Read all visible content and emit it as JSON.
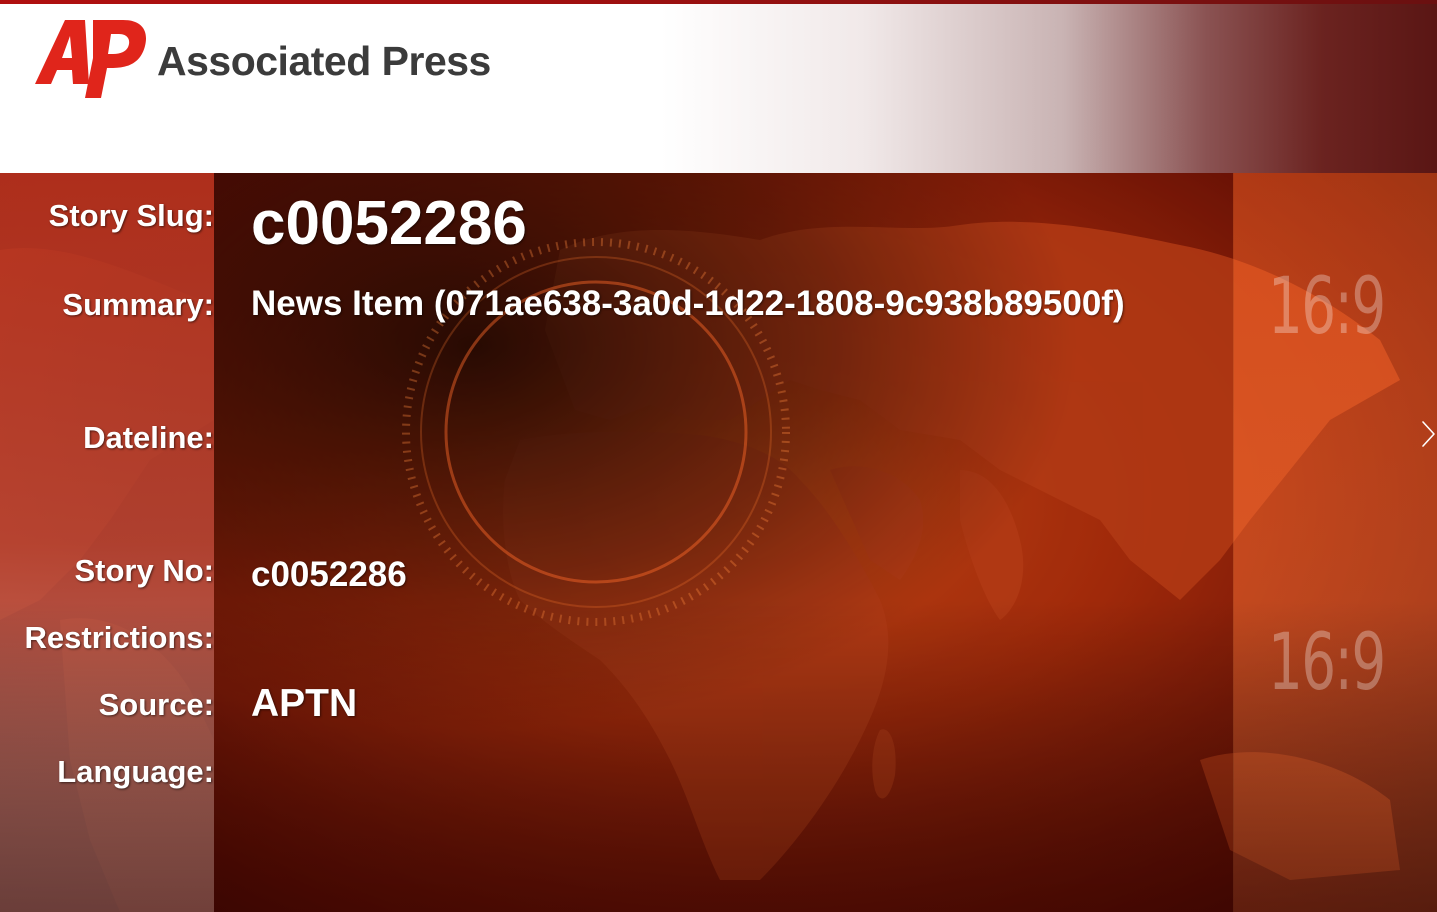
{
  "header": {
    "logo_text": "AP",
    "brand_name": "Associated Press"
  },
  "fields": {
    "story_slug": {
      "label": "Story Slug:",
      "value": "c0052286"
    },
    "summary": {
      "label": "Summary:",
      "value": "News Item (071ae638-3a0d-1d22-1808-9c938b89500f)"
    },
    "dateline": {
      "label": "Dateline:",
      "value": ""
    },
    "story_no": {
      "label": "Story No:",
      "value": "c0052286"
    },
    "restrictions": {
      "label": "Restrictions:",
      "value": ""
    },
    "source": {
      "label": "Source:",
      "value": "APTN"
    },
    "language": {
      "label": "Language:",
      "value": ""
    }
  },
  "aspect_marks": [
    "16:9",
    "16:9"
  ],
  "icons": {
    "next": "chevron-right-icon"
  },
  "colors": {
    "ap_red": "#e0251b",
    "brand_gray": "#3b3b3b",
    "background_red": "#c1320c",
    "text": "#ffffff"
  }
}
